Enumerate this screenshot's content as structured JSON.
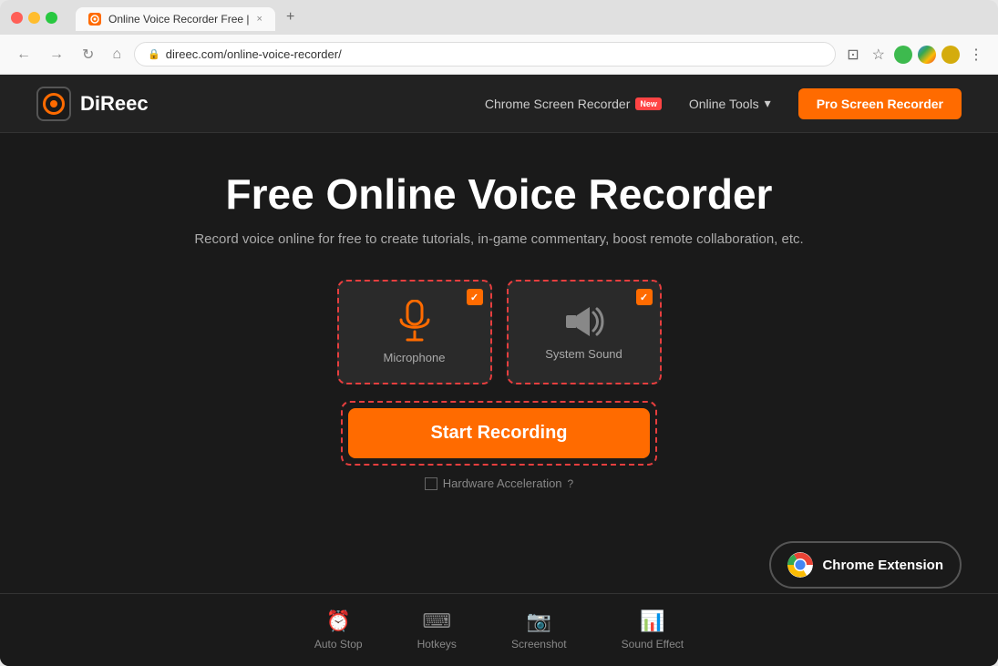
{
  "browser": {
    "tab_title": "Online Voice Recorder Free |",
    "tab_favicon": "🎙",
    "url": "direec.com/online-voice-recorder/",
    "new_tab_icon": "+",
    "close_tab_icon": "×"
  },
  "nav": {
    "logo_text": "DiReec",
    "chrome_screen_recorder": "Chrome Screen Recorder",
    "new_badge": "New",
    "online_tools": "Online Tools",
    "pro_btn": "Pro Screen Recorder"
  },
  "hero": {
    "title": "Free Online Voice Recorder",
    "subtitle": "Record voice online for free to create tutorials, in-game commentary, boost remote collaboration, etc."
  },
  "options": {
    "microphone_label": "Microphone",
    "system_sound_label": "System Sound",
    "mic_checked": true,
    "sound_checked": true
  },
  "buttons": {
    "start_recording": "Start Recording",
    "hardware_acceleration": "Hardware Acceleration",
    "chrome_extension": "Chrome Extension"
  },
  "toolbar": {
    "items": [
      {
        "icon": "⏰",
        "label": "Auto Stop"
      },
      {
        "icon": "⌨",
        "label": "Hotkeys"
      },
      {
        "icon": "📷",
        "label": "Screenshot"
      },
      {
        "icon": "📊",
        "label": "Sound Effect"
      }
    ]
  }
}
